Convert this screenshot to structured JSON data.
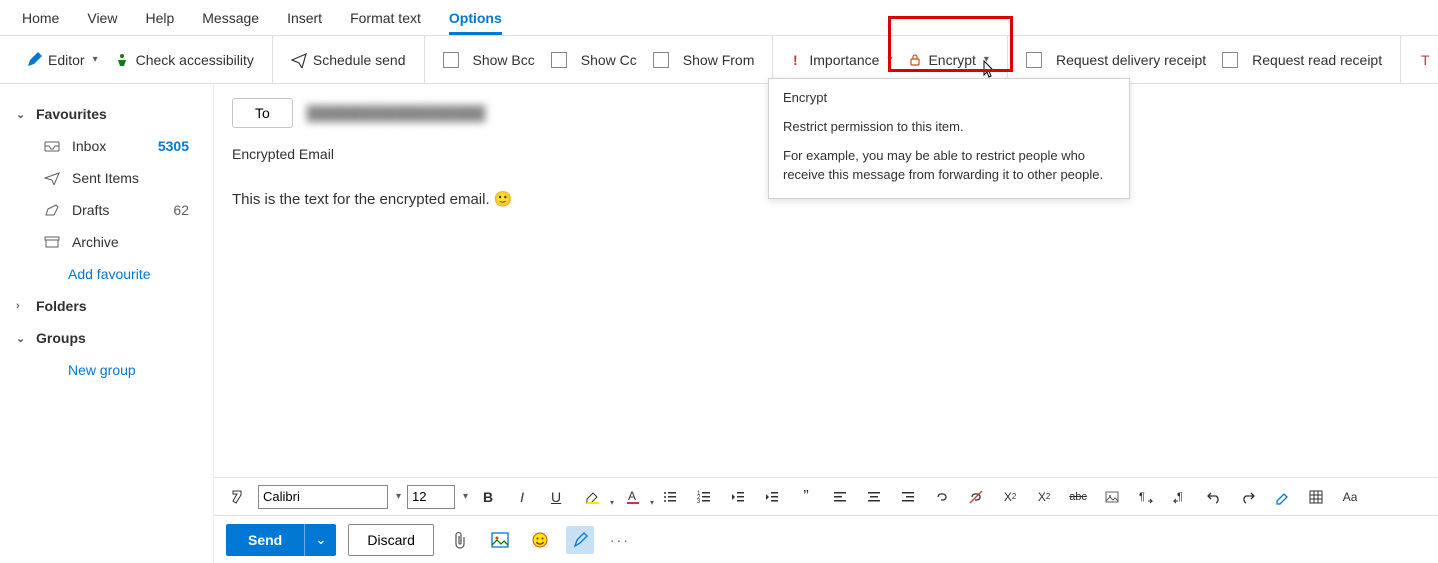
{
  "menubar": {
    "items": [
      "Home",
      "View",
      "Help",
      "Message",
      "Insert",
      "Format text",
      "Options"
    ],
    "active": "Options"
  },
  "ribbon": {
    "editor": "Editor",
    "check_access": "Check accessibility",
    "schedule": "Schedule send",
    "show_bcc": "Show Bcc",
    "show_cc": "Show Cc",
    "show_from": "Show From",
    "importance": "Importance",
    "encrypt": "Encrypt",
    "req_delivery": "Request delivery receipt",
    "req_read": "Request read receipt"
  },
  "tooltip": {
    "title": "Encrypt",
    "subtitle": "Restrict permission to this item.",
    "body": "For example, you may be able to restrict people who receive this message from forwarding it to other people."
  },
  "sidebar": {
    "favourites": "Favourites",
    "inbox": {
      "label": "Inbox",
      "count": "5305"
    },
    "sent": "Sent Items",
    "drafts": {
      "label": "Drafts",
      "count": "62"
    },
    "archive": "Archive",
    "add_fav": "Add favourite",
    "folders": "Folders",
    "groups": "Groups",
    "new_group": "New group"
  },
  "compose": {
    "to_label": "To",
    "recipient_preview": "██████████████████",
    "subject": "Encrypted Email",
    "body": "This is the text for the encrypted email.  🙂"
  },
  "format": {
    "font": "Calibri",
    "size": "12"
  },
  "actions": {
    "send": "Send",
    "discard": "Discard",
    "more": "···"
  }
}
